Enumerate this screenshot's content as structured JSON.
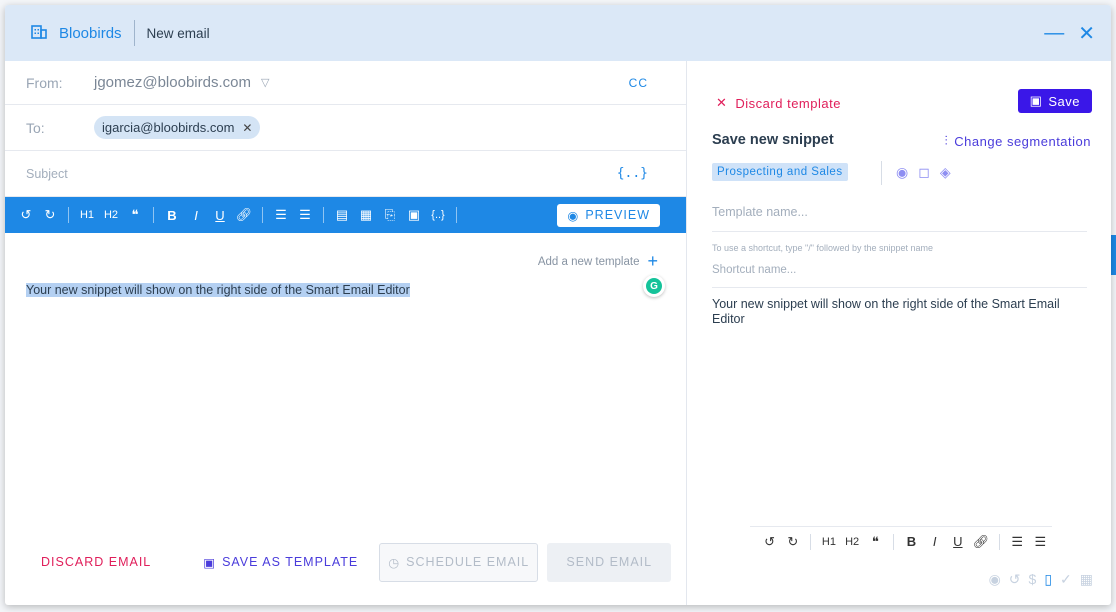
{
  "header": {
    "brand": "Bloobirds",
    "title": "New email"
  },
  "compose": {
    "from_label": "From:",
    "from_value": "jgomez@bloobirds.com",
    "cc_label": "CC",
    "to_label": "To:",
    "to_chip": "igarcia@bloobirds.com",
    "subject_placeholder": "Subject",
    "vars_icon": "{..}"
  },
  "toolbar": {
    "preview_label": "PREVIEW",
    "h1": "H1",
    "h2": "H2",
    "quote": "❝",
    "bold": "B",
    "italic": "I",
    "underline": "U"
  },
  "editor": {
    "add_template_label": "Add a new template",
    "body_text": "Your new snippet will show on the right side of the Smart Email Editor"
  },
  "footer": {
    "discard": "DISCARD EMAIL",
    "save_as_template": "SAVE AS TEMPLATE",
    "schedule": "SCHEDULE EMAIL",
    "send": "SEND EMAIL"
  },
  "snippet": {
    "discard_template": "Discard template",
    "save": "Save",
    "title": "Save new snippet",
    "change_segmentation": "Change segmentation",
    "segment_tag": "Prospecting and Sales",
    "template_name_placeholder": "Template name...",
    "shortcut_hint": "To use a shortcut, type \"/\" followed by the snippet name",
    "shortcut_placeholder": "Shortcut name...",
    "body_text": "Your new snippet will show on the right side of the Smart Email Editor"
  },
  "colors": {
    "accent": "#1e88e5",
    "danger": "#e01e5a",
    "purple": "#3a17e8"
  }
}
